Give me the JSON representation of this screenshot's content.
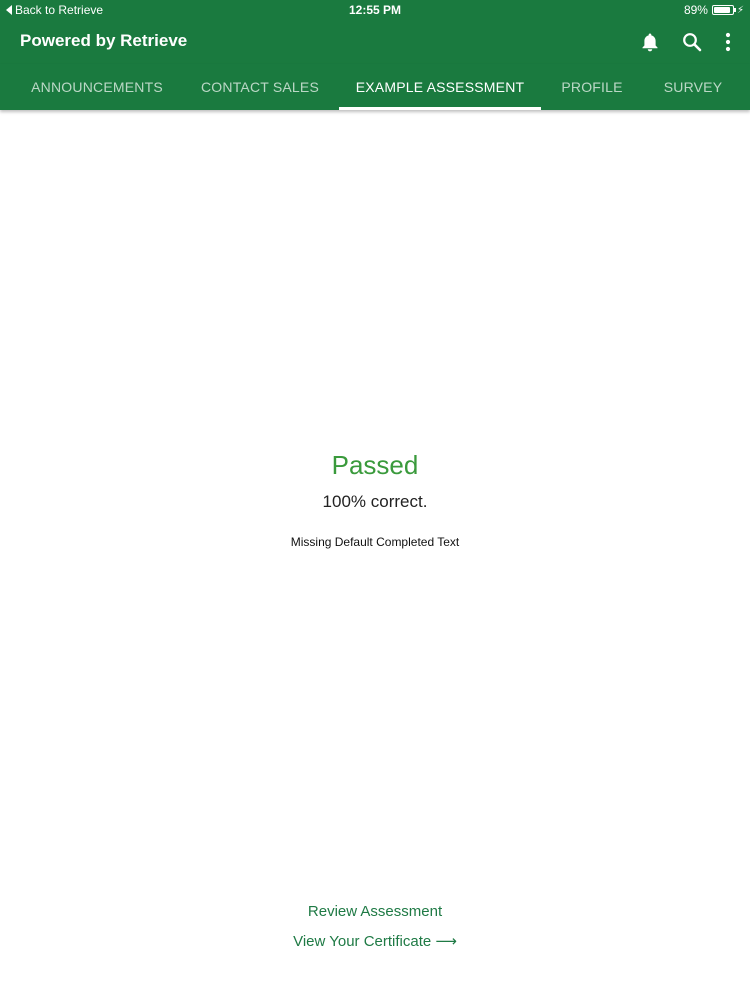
{
  "status_bar": {
    "back_label": "Back to Retrieve",
    "time": "12:55 PM",
    "battery_percent_label": "89%",
    "battery_level": 0.89
  },
  "app_bar": {
    "title": "Powered by Retrieve",
    "actions": [
      "bell-icon",
      "search-icon",
      "more-vert-icon"
    ]
  },
  "tabs": [
    {
      "label": "ANNOUNCEMENTS",
      "active": false
    },
    {
      "label": "CONTACT SALES",
      "active": false
    },
    {
      "label": "EXAMPLE ASSESSMENT",
      "active": true
    },
    {
      "label": "PROFILE",
      "active": false
    },
    {
      "label": "SURVEY",
      "active": false
    }
  ],
  "result": {
    "status": "Passed",
    "score": "100% correct.",
    "completed_text": "Missing Default Completed Text"
  },
  "links": {
    "review": "Review Assessment",
    "certificate": "View Your Certificate ⟶"
  },
  "colors": {
    "brand_green": "#1a7a3f",
    "passed_green": "#3a9a3c",
    "link_green": "#1f7a45"
  }
}
